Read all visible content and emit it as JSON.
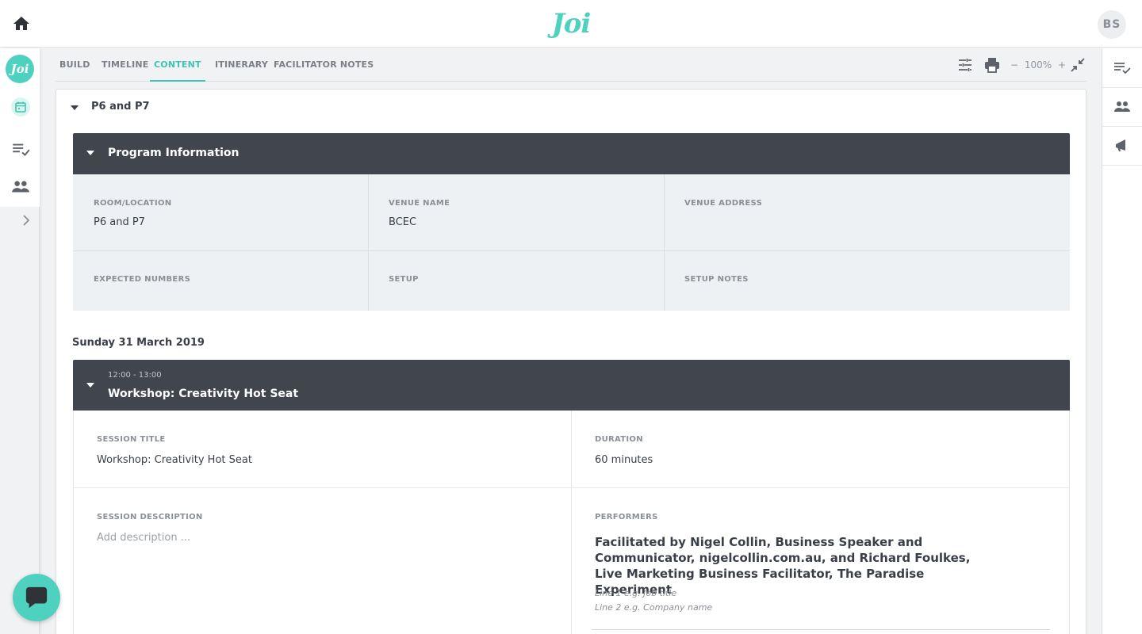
{
  "topbar": {
    "logo": "Joi",
    "avatar_initials": "BS"
  },
  "leftbar": {
    "badge": "Joi"
  },
  "tabs": [
    {
      "label": "BUILD"
    },
    {
      "label": "TIMELINE"
    },
    {
      "label": "CONTENT",
      "active": true
    },
    {
      "label": "ITINERARY"
    },
    {
      "label": "FACILITATOR NOTES"
    }
  ],
  "toolbar": {
    "zoom_minus": "−",
    "zoom_level": "100%",
    "zoom_plus": "+"
  },
  "group": {
    "title": "P6 and P7"
  },
  "program_info": {
    "title": "Program Information",
    "room_label": "ROOM/LOCATION",
    "room_value": "P6 and P7",
    "venue_name_label": "VENUE NAME",
    "venue_name_value": "BCEC",
    "venue_address_label": "VENUE ADDRESS",
    "expected_label": "EXPECTED NUMBERS",
    "setup_label": "SETUP",
    "setup_notes_label": "SETUP NOTES"
  },
  "date_heading": "Sunday 31 March 2019",
  "session": {
    "time": "12:00 - 13:00",
    "title": "Workshop: Creativity Hot Seat",
    "session_title_label": "SESSION TITLE",
    "session_title_value": "Workshop: Creativity Hot Seat",
    "duration_label": "DURATION",
    "duration_value": "60 minutes",
    "description_label": "SESSION DESCRIPTION",
    "description_placeholder": "Add description ...",
    "performers_label": "PERFORMERS",
    "performer_text": "Facilitated by Nigel Collin, Business Speaker and Communicator, nigelcollin.com.au, and Richard Foulkes, Live Marketing Business Facilitator, The Paradise Experiment",
    "line1_hint": "Line 1 e.g. Job title",
    "line2_hint": "Line 2 e.g. Company name"
  },
  "colors": {
    "accent": "#4fd1bf",
    "dark_bar": "#41454e"
  }
}
